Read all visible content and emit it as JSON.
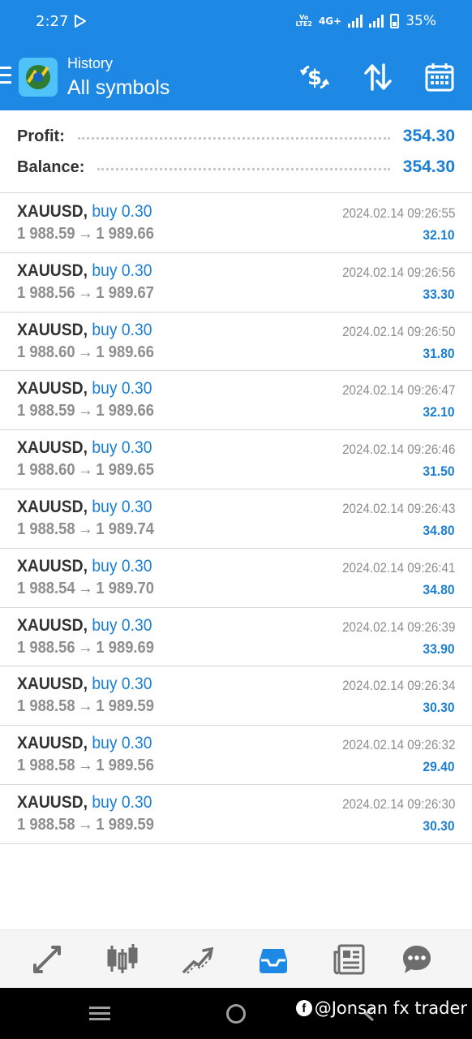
{
  "status_bar": {
    "time": "2:27",
    "volte": "Vo\nLTE2",
    "network": "4G+",
    "battery": "35%"
  },
  "header": {
    "subtitle": "History",
    "title": "All symbols",
    "icons": [
      "menu-icon",
      "dollar-exchange-icon",
      "sort-icon",
      "calendar-icon"
    ]
  },
  "summary": {
    "profit_label": "Profit:",
    "profit_value": "354.30",
    "balance_label": "Balance:",
    "balance_value": "354.30"
  },
  "deals": [
    {
      "symbol": "XAUUSD,",
      "type": "buy 0.30",
      "open": "1 988.59",
      "arrow": "→",
      "close": "1 989.66",
      "time": "2024.02.14 09:26:55",
      "profit": "32.10"
    },
    {
      "symbol": "XAUUSD,",
      "type": "buy 0.30",
      "open": "1 988.56",
      "arrow": "→",
      "close": "1 989.67",
      "time": "2024.02.14 09:26:56",
      "profit": "33.30"
    },
    {
      "symbol": "XAUUSD,",
      "type": "buy 0.30",
      "open": "1 988.60",
      "arrow": "→",
      "close": "1 989.66",
      "time": "2024.02.14 09:26:50",
      "profit": "31.80"
    },
    {
      "symbol": "XAUUSD,",
      "type": "buy 0.30",
      "open": "1 988.59",
      "arrow": "→",
      "close": "1 989.66",
      "time": "2024.02.14 09:26:47",
      "profit": "32.10"
    },
    {
      "symbol": "XAUUSD,",
      "type": "buy 0.30",
      "open": "1 988.60",
      "arrow": "→",
      "close": "1 989.65",
      "time": "2024.02.14 09:26:46",
      "profit": "31.50"
    },
    {
      "symbol": "XAUUSD,",
      "type": "buy 0.30",
      "open": "1 988.58",
      "arrow": "→",
      "close": "1 989.74",
      "time": "2024.02.14 09:26:43",
      "profit": "34.80"
    },
    {
      "symbol": "XAUUSD,",
      "type": "buy 0.30",
      "open": "1 988.54",
      "arrow": "→",
      "close": "1 989.70",
      "time": "2024.02.14 09:26:41",
      "profit": "34.80"
    },
    {
      "symbol": "XAUUSD,",
      "type": "buy 0.30",
      "open": "1 988.56",
      "arrow": "→",
      "close": "1 989.69",
      "time": "2024.02.14 09:26:39",
      "profit": "33.90"
    },
    {
      "symbol": "XAUUSD,",
      "type": "buy 0.30",
      "open": "1 988.58",
      "arrow": "→",
      "close": "1 989.59",
      "time": "2024.02.14 09:26:34",
      "profit": "30.30"
    },
    {
      "symbol": "XAUUSD,",
      "type": "buy 0.30",
      "open": "1 988.58",
      "arrow": "→",
      "close": "1 989.56",
      "time": "2024.02.14 09:26:32",
      "profit": "29.40"
    },
    {
      "symbol": "XAUUSD,",
      "type": "buy 0.30",
      "open": "1 988.58",
      "arrow": "→",
      "close": "1 989.59",
      "time": "2024.02.14 09:26:30",
      "profit": "30.30"
    }
  ],
  "tabs": [
    {
      "name": "quotes-icon"
    },
    {
      "name": "chart-icon"
    },
    {
      "name": "trade-icon"
    },
    {
      "name": "history-icon",
      "active": true
    },
    {
      "name": "news-icon"
    },
    {
      "name": "chat-icon"
    }
  ],
  "watermark": {
    "text": "@Jonsan fx trader"
  },
  "colors": {
    "accent": "#1e88e5",
    "value_blue": "#1a7fd4",
    "muted": "#8e8e8e",
    "active_tab": "#1e88e5",
    "inactive_tab": "#6d6d6d"
  }
}
